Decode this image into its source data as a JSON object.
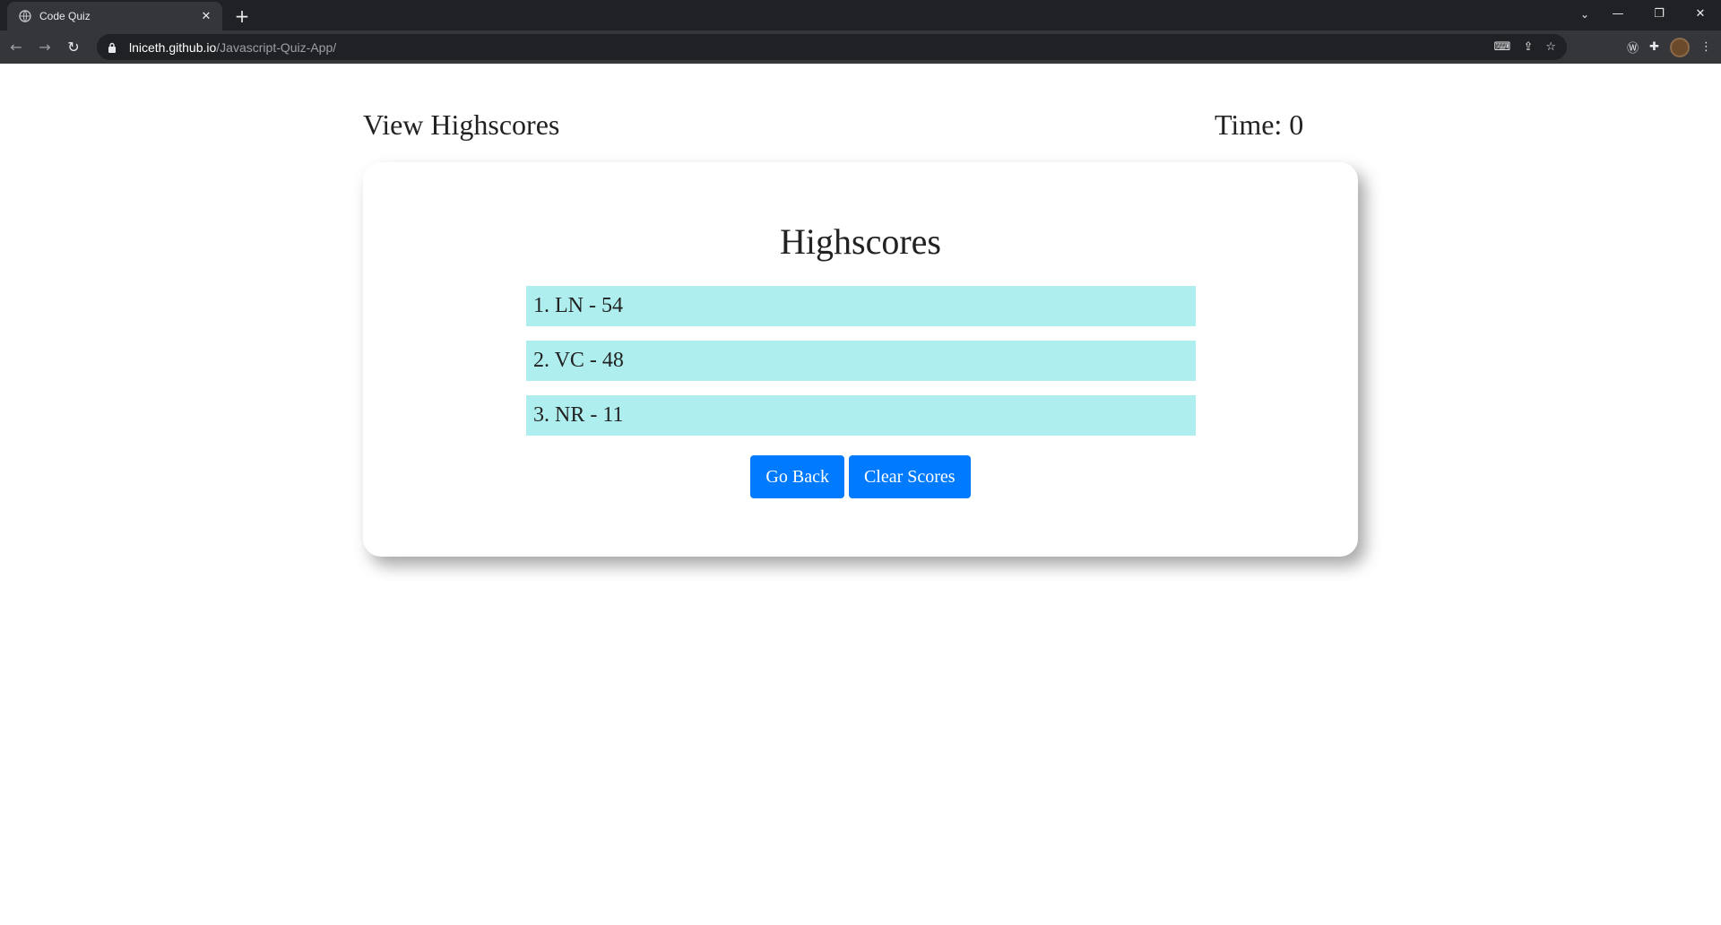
{
  "browser": {
    "tab_title": "Code Quiz",
    "tab_close": "✕",
    "new_tab": "+",
    "url_domain": "lniceth.github.io",
    "url_path": "/Javascript-Quiz-App/",
    "icons": [
      "back-icon",
      "forward-icon",
      "reload-icon",
      "lock-icon",
      "translate-icon",
      "share-icon",
      "star-icon",
      "extension-icon",
      "puzzle-icon",
      "profile-avatar",
      "menu-icon"
    ]
  },
  "header": {
    "view_highscores": "View Highscores",
    "timer": "Time: 0"
  },
  "card": {
    "title": "Highscores",
    "scores": [
      "1. LN - 54",
      "2. VC - 48",
      "3. NR - 11"
    ],
    "go_back_label": "Go Back",
    "clear_label": "Clear Scores"
  },
  "colors": {
    "accent": "#007bff",
    "score_bg": "#afeeee",
    "chrome_dark": "#202124",
    "chrome_mid": "#35363a"
  }
}
